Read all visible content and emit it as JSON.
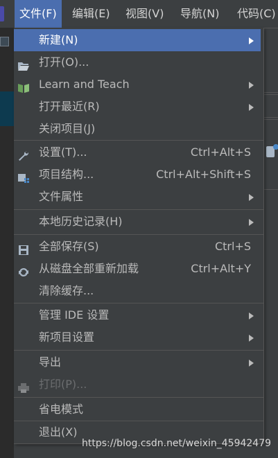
{
  "menubar": {
    "items": [
      "文件(F)",
      "编辑(E)",
      "视图(V)",
      "导航(N)",
      "代码(C)"
    ]
  },
  "file_menu": {
    "items": [
      {
        "label": "新建(N)",
        "icon": "none",
        "submenu": true,
        "selected": true
      },
      {
        "label": "打开(O)...",
        "icon": "folder-open-icon"
      },
      {
        "label": "Learn and Teach",
        "icon": "book-icon",
        "submenu": true
      },
      {
        "label": "打开最近(R)",
        "submenu": true
      },
      {
        "label": "关闭项目(J)"
      },
      {
        "label": "设置(T)...",
        "icon": "wrench-icon",
        "shortcut": "Ctrl+Alt+S"
      },
      {
        "label": "项目结构...",
        "icon": "project-structure-icon",
        "shortcut": "Ctrl+Alt+Shift+S"
      },
      {
        "label": "文件属性",
        "submenu": true
      },
      {
        "label": "本地历史记录(H)",
        "submenu": true
      },
      {
        "label": "全部保存(S)",
        "icon": "save-icon",
        "shortcut": "Ctrl+S"
      },
      {
        "label": "从磁盘全部重新加载",
        "icon": "reload-icon",
        "shortcut": "Ctrl+Alt+Y"
      },
      {
        "label": "清除缓存..."
      },
      {
        "label": "管理 IDE 设置",
        "submenu": true
      },
      {
        "label": "新项目设置",
        "submenu": true
      },
      {
        "label": "导出",
        "submenu": true
      },
      {
        "label": "打印(P)...",
        "icon": "print-icon",
        "disabled": true
      },
      {
        "label": "省电模式"
      },
      {
        "label": "退出(X)"
      }
    ]
  },
  "watermark": "https://blog.csdn.net/weixin_45942479",
  "colors": {
    "accent": "#4b6eaf",
    "background": "#3c3f41",
    "text": "#bbbbbb"
  }
}
